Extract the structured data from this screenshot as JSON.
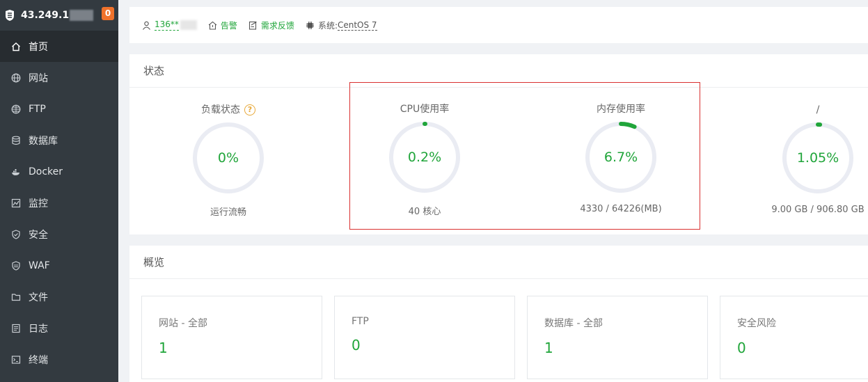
{
  "sidebar": {
    "ip": "43.249.1",
    "badge": "0",
    "items": [
      {
        "label": "首页",
        "icon": "home-icon",
        "active": true
      },
      {
        "label": "网站",
        "icon": "globe-icon"
      },
      {
        "label": "FTP",
        "icon": "ftp-globe-icon"
      },
      {
        "label": "数据库",
        "icon": "database-icon"
      },
      {
        "label": "Docker",
        "icon": "docker-icon"
      },
      {
        "label": "监控",
        "icon": "monitor-icon"
      },
      {
        "label": "安全",
        "icon": "shield-icon"
      },
      {
        "label": "WAF",
        "icon": "waf-shield-icon"
      },
      {
        "label": "文件",
        "icon": "folder-icon"
      },
      {
        "label": "日志",
        "icon": "log-icon"
      },
      {
        "label": "终端",
        "icon": "terminal-icon"
      }
    ]
  },
  "topbar": {
    "user": "136**",
    "alert": "告警",
    "feedback": "需求反馈",
    "system_label": "系统:",
    "system_value": "CentOS 7"
  },
  "status": {
    "title": "状态",
    "gauges": [
      {
        "title": "负载状态",
        "value": "0%",
        "sub": "运行流畅",
        "fraction": 0.0
      },
      {
        "title": "CPU使用率",
        "value": "0.2%",
        "sub": "40 核心",
        "fraction": 0.002
      },
      {
        "title": "内存使用率",
        "value": "6.7%",
        "sub": "4330 / 64226(MB)",
        "fraction": 0.067
      },
      {
        "title": "/",
        "value": "1.05%",
        "sub": "9.00 GB / 906.80 GB",
        "fraction": 0.0105
      }
    ]
  },
  "overview": {
    "title": "概览",
    "boxes": [
      {
        "label": "网站 - 全部",
        "value": "1"
      },
      {
        "label": "FTP",
        "value": "0"
      },
      {
        "label": "数据库 - 全部",
        "value": "1"
      },
      {
        "label": "安全风险",
        "value": "0"
      }
    ]
  },
  "colors": {
    "accent": "#20a53a",
    "sidebar_bg": "#333a40",
    "badge": "#f0722b",
    "highlight": "#d9302f",
    "ring_track": "#eaecf3"
  }
}
